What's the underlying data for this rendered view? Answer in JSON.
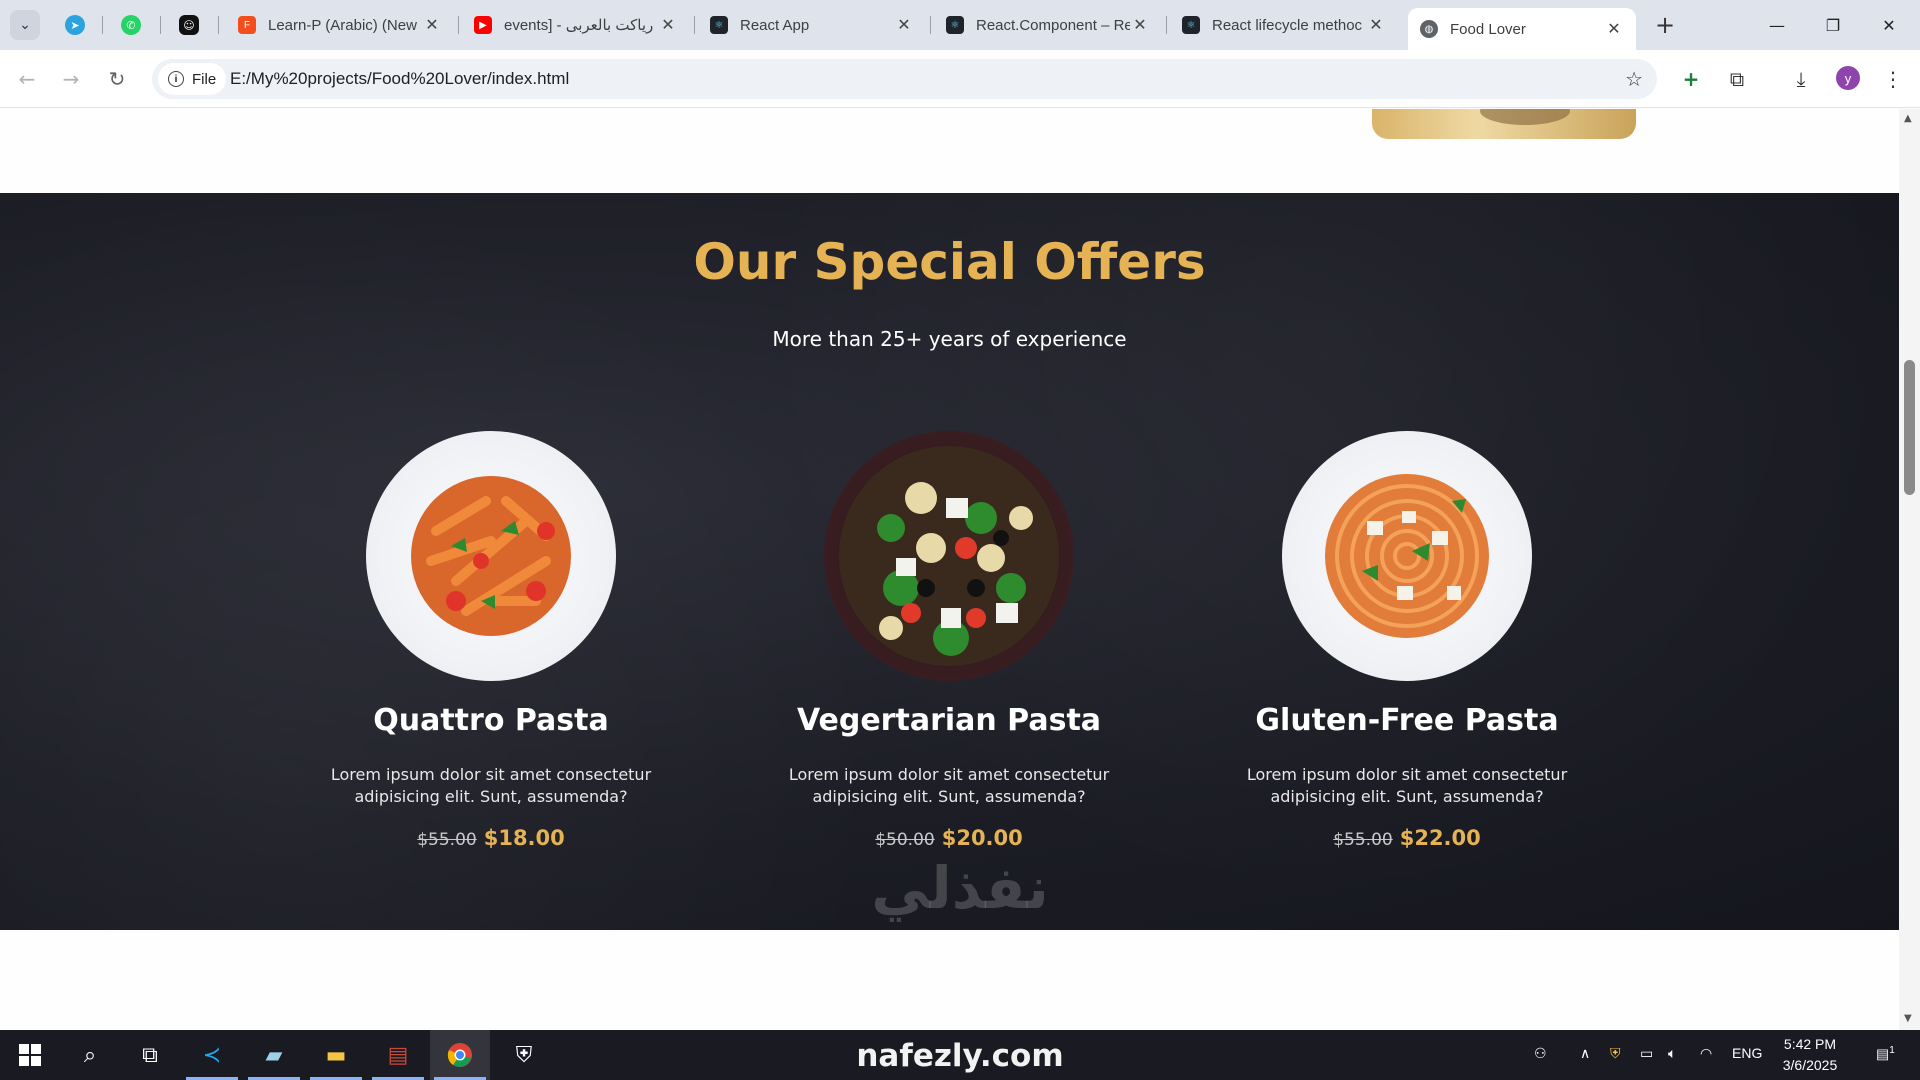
{
  "browser": {
    "pinned_tabs": [
      "telegram-icon",
      "whatsapp-icon",
      "chat-icon"
    ],
    "tabs": [
      {
        "title": "Learn-P (Arabic) (New",
        "icon": "figma-icon"
      },
      {
        "title": "events] - رياكت بالعربى",
        "icon": "youtube-icon"
      },
      {
        "title": "React App",
        "icon": "react-icon"
      },
      {
        "title": "React.Component – Re",
        "icon": "react-icon"
      },
      {
        "title": "React lifecycle methoc",
        "icon": "react-icon"
      },
      {
        "title": "Food Lover",
        "icon": "globe-icon",
        "active": true
      }
    ],
    "address": {
      "scheme_label": "File",
      "url": "E:/My%20projects/Food%20Lover/index.html"
    },
    "profile_initial": "y"
  },
  "offers": {
    "title": "Our Special Offers",
    "subtitle": "More than 25+ years of experience",
    "items": [
      {
        "name": "Quattro Pasta",
        "description": "Lorem ipsum dolor sit amet consectetur adipisicing elit. Sunt, assumenda?",
        "old_price": "$55.00",
        "new_price": "$18.00"
      },
      {
        "name": "Vegertarian Pasta",
        "description": "Lorem ipsum dolor sit amet consectetur adipisicing elit. Sunt, assumenda?",
        "old_price": "$50.00",
        "new_price": "$20.00"
      },
      {
        "name": "Gluten-Free Pasta",
        "description": "Lorem ipsum dolor sit amet consectetur adipisicing elit. Sunt, assumenda?",
        "old_price": "$55.00",
        "new_price": "$22.00"
      }
    ]
  },
  "watermark": {
    "arabic": "نفذلي",
    "latin": "nafezly.com"
  },
  "taskbar": {
    "language": "ENG",
    "time": "5:42 PM",
    "date": "3/6/2025",
    "notification_count": "1"
  },
  "colors": {
    "accent_gold": "#e5b354",
    "section_bg": "#1c1d25"
  }
}
